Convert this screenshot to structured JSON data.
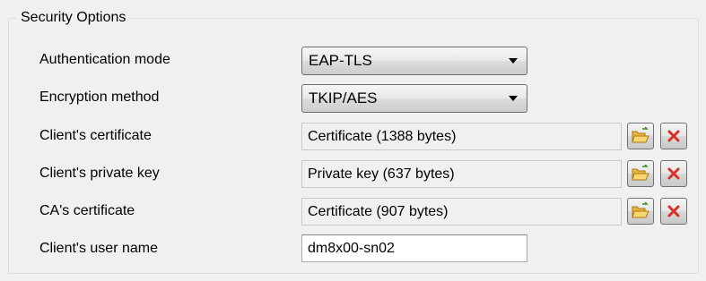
{
  "group": {
    "title": "Security Options"
  },
  "rows": {
    "auth": {
      "label": "Authentication mode",
      "value": "EAP-TLS"
    },
    "enc": {
      "label": "Encryption method",
      "value": "TKIP/AES"
    },
    "client_cert": {
      "label": "Client's certificate",
      "value": "Certificate (1388 bytes)"
    },
    "private_key": {
      "label": "Client's private key",
      "value": "Private key (637 bytes)"
    },
    "ca_cert": {
      "label": "CA's certificate",
      "value": "Certificate (907 bytes)"
    },
    "user_name": {
      "label": "Client's user name",
      "value": "dm8x00-sn02"
    }
  },
  "icons": {
    "open": "folder-open-icon",
    "remove": "delete-x-icon"
  },
  "colors": {
    "delete": "#d93025",
    "folder": "#f2c144"
  }
}
